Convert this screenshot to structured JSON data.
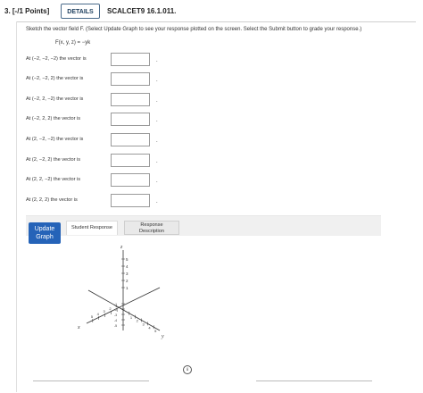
{
  "header": {
    "points": "3. [-/1 Points]",
    "details_label": "DETAILS",
    "problem_code": "SCALCET9 16.1.011."
  },
  "instructions": "Sketch the vector field F. (Select Update Graph to see your response plotted on the screen. Select the Submit button to grade your response.)",
  "formula": "F(x, y, z) = −yk",
  "questions": [
    {
      "label": "At (−2, −2, −2) the vector is",
      "value": ""
    },
    {
      "label": "At (−2, −2, 2) the vector is",
      "value": ""
    },
    {
      "label": "At (−2, 2, −2) the vector is",
      "value": ""
    },
    {
      "label": "At (−2, 2, 2) the vector is",
      "value": ""
    },
    {
      "label": "At (2, −2, −2) the vector is",
      "value": ""
    },
    {
      "label": "At (2, −2, 2) the vector is",
      "value": ""
    },
    {
      "label": "At (2, 2, −2) the vector is",
      "value": ""
    },
    {
      "label": "At (2, 2, 2) the vector is",
      "value": ""
    }
  ],
  "period": ".",
  "graph": {
    "update_label_line1": "Update",
    "update_label_line2": "Graph",
    "tab_student": "Student Response",
    "tab_desc_line1": "Response",
    "tab_desc_line2": "Description",
    "axis_z": "z",
    "axis_y": "y",
    "axis_x": "x",
    "info_icon": "ⓘ",
    "tick_labels": [
      "5",
      "4",
      "3",
      "2",
      "1"
    ],
    "neg_tick_labels": [
      "-5",
      "-4",
      "-3",
      "-2",
      "-1"
    ],
    "accent_color": "#2563b8"
  }
}
